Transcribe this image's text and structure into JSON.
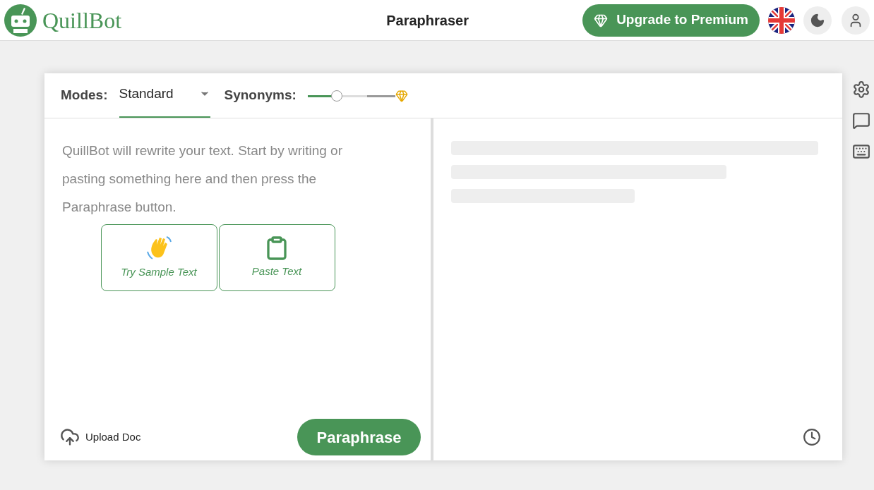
{
  "header": {
    "logo_text": "QuillBot",
    "title": "Paraphraser",
    "upgrade_button": "Upgrade to Premium"
  },
  "toolbar": {
    "modes_label": "Modes:",
    "mode": "Standard",
    "synonyms_label": "Synonyms:",
    "synonyms": {
      "level": 0.33
    }
  },
  "input": {
    "placeholder": "QuillBot will rewrite your text. Start by writing or pasting something here and then press the Paraphrase button.",
    "actions": [
      {
        "kind": "sample",
        "label": "Try Sample Text"
      },
      {
        "kind": "paste",
        "label": "Paste Text"
      }
    ],
    "upload": "Upload Doc",
    "submit": "Paraphrase"
  },
  "output": {
    "loading": true
  }
}
